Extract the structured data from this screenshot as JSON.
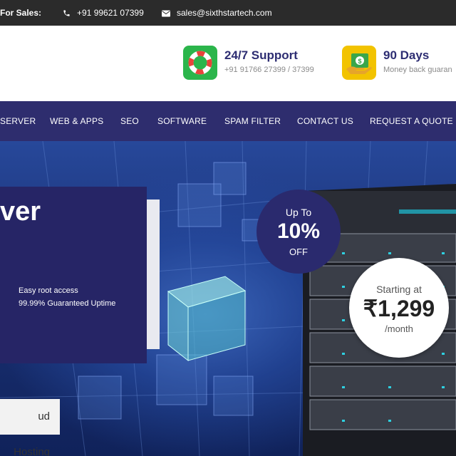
{
  "topbar": {
    "sales_label": "For Sales:",
    "phone": "+91 99621 07399",
    "email": "sales@sixthstartech.com",
    "phone_icon": "phone-icon",
    "email_icon": "envelope-icon"
  },
  "header": {
    "support": {
      "title": "24/7 Support",
      "subtitle": "+91 91766 27399 / 37399",
      "icon": "lifebuoy-icon",
      "icon_color": "#2bb54b"
    },
    "guarantee": {
      "title": "90 Days",
      "subtitle": "Money back guaran",
      "icon": "money-icon",
      "icon_color": "#f2c300"
    }
  },
  "nav": {
    "items": [
      "SERVER",
      "WEB & APPS",
      "SEO",
      "SOFTWARE",
      "SPAM FILTER",
      "CONTACT US",
      "REQUEST A QUOTE"
    ]
  },
  "hero": {
    "title": "ver",
    "features": [
      "Easy root access",
      "99.99% Guaranteed Uptime"
    ],
    "cta_label": "ud Hosting",
    "discount": {
      "up_to": "Up To",
      "percent": "10%",
      "off": "OFF"
    },
    "price": {
      "starting": "Starting at",
      "amount": "₹1,299",
      "period": "/month"
    }
  },
  "colors": {
    "nav_bg": "#2e2d6e",
    "topbar_bg": "#2b2b2b",
    "accent": "#2d2d72"
  }
}
